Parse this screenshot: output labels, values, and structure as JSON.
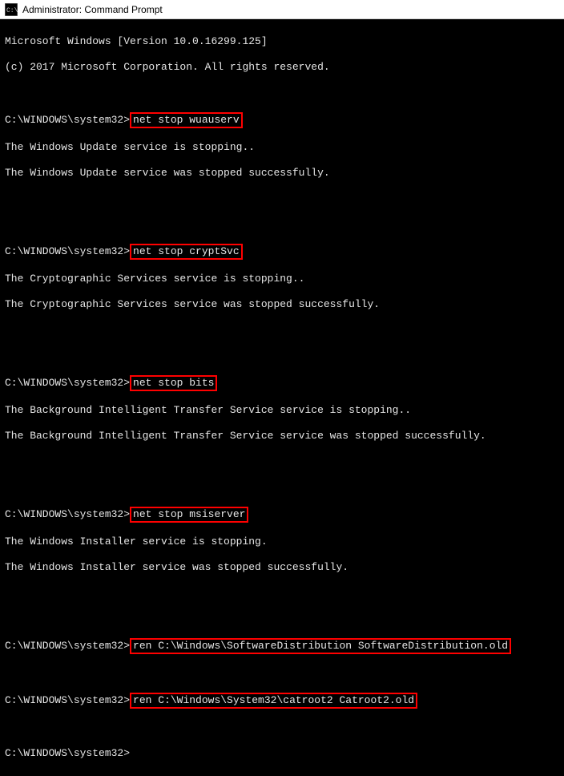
{
  "titlebar": {
    "text": "Administrator: Command Prompt"
  },
  "terminal": {
    "banner1": "Microsoft Windows [Version 10.0.16299.125]",
    "banner2": "(c) 2017 Microsoft Corporation. All rights reserved.",
    "prompt": "C:\\WINDOWS\\system32>",
    "cmd1": "net stop wuauserv",
    "out1a": "The Windows Update service is stopping..",
    "out1b": "The Windows Update service was stopped successfully.",
    "cmd2": "net stop cryptSvc",
    "out2a": "The Cryptographic Services service is stopping..",
    "out2b": "The Cryptographic Services service was stopped successfully.",
    "cmd3": "net stop bits",
    "out3a": "The Background Intelligent Transfer Service service is stopping..",
    "out3b": "The Background Intelligent Transfer Service service was stopped successfully.",
    "cmd4": "net stop msiserver",
    "out4a": "The Windows Installer service is stopping.",
    "out4b": "The Windows Installer service was stopped successfully.",
    "cmd5": "ren C:\\Windows\\SoftwareDistribution SoftwareDistribution.old",
    "cmd6": "ren C:\\Windows\\System32\\catroot2 Catroot2.old"
  }
}
